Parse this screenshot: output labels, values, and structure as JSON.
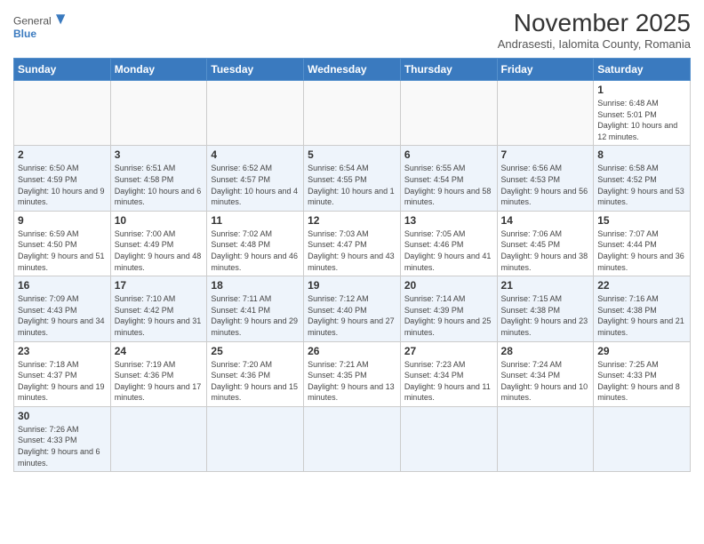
{
  "logo": {
    "text_general": "General",
    "text_blue": "Blue"
  },
  "header": {
    "month_title": "November 2025",
    "subtitle": "Andrasesti, Ialomita County, Romania"
  },
  "weekdays": [
    "Sunday",
    "Monday",
    "Tuesday",
    "Wednesday",
    "Thursday",
    "Friday",
    "Saturday"
  ],
  "weeks": [
    [
      {
        "day": "",
        "info": ""
      },
      {
        "day": "",
        "info": ""
      },
      {
        "day": "",
        "info": ""
      },
      {
        "day": "",
        "info": ""
      },
      {
        "day": "",
        "info": ""
      },
      {
        "day": "",
        "info": ""
      },
      {
        "day": "1",
        "info": "Sunrise: 6:48 AM\nSunset: 5:01 PM\nDaylight: 10 hours and 12 minutes."
      }
    ],
    [
      {
        "day": "2",
        "info": "Sunrise: 6:50 AM\nSunset: 4:59 PM\nDaylight: 10 hours and 9 minutes."
      },
      {
        "day": "3",
        "info": "Sunrise: 6:51 AM\nSunset: 4:58 PM\nDaylight: 10 hours and 6 minutes."
      },
      {
        "day": "4",
        "info": "Sunrise: 6:52 AM\nSunset: 4:57 PM\nDaylight: 10 hours and 4 minutes."
      },
      {
        "day": "5",
        "info": "Sunrise: 6:54 AM\nSunset: 4:55 PM\nDaylight: 10 hours and 1 minute."
      },
      {
        "day": "6",
        "info": "Sunrise: 6:55 AM\nSunset: 4:54 PM\nDaylight: 9 hours and 58 minutes."
      },
      {
        "day": "7",
        "info": "Sunrise: 6:56 AM\nSunset: 4:53 PM\nDaylight: 9 hours and 56 minutes."
      },
      {
        "day": "8",
        "info": "Sunrise: 6:58 AM\nSunset: 4:52 PM\nDaylight: 9 hours and 53 minutes."
      }
    ],
    [
      {
        "day": "9",
        "info": "Sunrise: 6:59 AM\nSunset: 4:50 PM\nDaylight: 9 hours and 51 minutes."
      },
      {
        "day": "10",
        "info": "Sunrise: 7:00 AM\nSunset: 4:49 PM\nDaylight: 9 hours and 48 minutes."
      },
      {
        "day": "11",
        "info": "Sunrise: 7:02 AM\nSunset: 4:48 PM\nDaylight: 9 hours and 46 minutes."
      },
      {
        "day": "12",
        "info": "Sunrise: 7:03 AM\nSunset: 4:47 PM\nDaylight: 9 hours and 43 minutes."
      },
      {
        "day": "13",
        "info": "Sunrise: 7:05 AM\nSunset: 4:46 PM\nDaylight: 9 hours and 41 minutes."
      },
      {
        "day": "14",
        "info": "Sunrise: 7:06 AM\nSunset: 4:45 PM\nDaylight: 9 hours and 38 minutes."
      },
      {
        "day": "15",
        "info": "Sunrise: 7:07 AM\nSunset: 4:44 PM\nDaylight: 9 hours and 36 minutes."
      }
    ],
    [
      {
        "day": "16",
        "info": "Sunrise: 7:09 AM\nSunset: 4:43 PM\nDaylight: 9 hours and 34 minutes."
      },
      {
        "day": "17",
        "info": "Sunrise: 7:10 AM\nSunset: 4:42 PM\nDaylight: 9 hours and 31 minutes."
      },
      {
        "day": "18",
        "info": "Sunrise: 7:11 AM\nSunset: 4:41 PM\nDaylight: 9 hours and 29 minutes."
      },
      {
        "day": "19",
        "info": "Sunrise: 7:12 AM\nSunset: 4:40 PM\nDaylight: 9 hours and 27 minutes."
      },
      {
        "day": "20",
        "info": "Sunrise: 7:14 AM\nSunset: 4:39 PM\nDaylight: 9 hours and 25 minutes."
      },
      {
        "day": "21",
        "info": "Sunrise: 7:15 AM\nSunset: 4:38 PM\nDaylight: 9 hours and 23 minutes."
      },
      {
        "day": "22",
        "info": "Sunrise: 7:16 AM\nSunset: 4:38 PM\nDaylight: 9 hours and 21 minutes."
      }
    ],
    [
      {
        "day": "23",
        "info": "Sunrise: 7:18 AM\nSunset: 4:37 PM\nDaylight: 9 hours and 19 minutes."
      },
      {
        "day": "24",
        "info": "Sunrise: 7:19 AM\nSunset: 4:36 PM\nDaylight: 9 hours and 17 minutes."
      },
      {
        "day": "25",
        "info": "Sunrise: 7:20 AM\nSunset: 4:36 PM\nDaylight: 9 hours and 15 minutes."
      },
      {
        "day": "26",
        "info": "Sunrise: 7:21 AM\nSunset: 4:35 PM\nDaylight: 9 hours and 13 minutes."
      },
      {
        "day": "27",
        "info": "Sunrise: 7:23 AM\nSunset: 4:34 PM\nDaylight: 9 hours and 11 minutes."
      },
      {
        "day": "28",
        "info": "Sunrise: 7:24 AM\nSunset: 4:34 PM\nDaylight: 9 hours and 10 minutes."
      },
      {
        "day": "29",
        "info": "Sunrise: 7:25 AM\nSunset: 4:33 PM\nDaylight: 9 hours and 8 minutes."
      }
    ],
    [
      {
        "day": "30",
        "info": "Sunrise: 7:26 AM\nSunset: 4:33 PM\nDaylight: 9 hours and 6 minutes."
      },
      {
        "day": "",
        "info": ""
      },
      {
        "day": "",
        "info": ""
      },
      {
        "day": "",
        "info": ""
      },
      {
        "day": "",
        "info": ""
      },
      {
        "day": "",
        "info": ""
      },
      {
        "day": "",
        "info": ""
      }
    ]
  ]
}
